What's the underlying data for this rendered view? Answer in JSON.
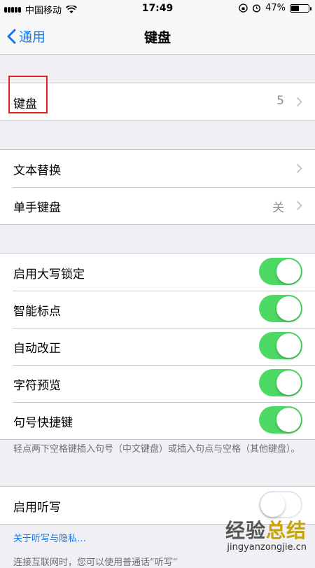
{
  "status_bar": {
    "carrier": "中国移动",
    "time": "17:49",
    "battery_percent": "47%",
    "battery_level": 0.47,
    "icons": [
      "signal-icon",
      "wifi-icon",
      "lock-rotation-icon",
      "alarm-icon",
      "battery-icon"
    ]
  },
  "nav": {
    "back_label": "通用",
    "title": "键盘"
  },
  "group1": {
    "keyboards": {
      "label": "键盘",
      "value": "5"
    }
  },
  "group2": {
    "text_replacement": {
      "label": "文本替换"
    },
    "one_handed": {
      "label": "单手键盘",
      "value": "关"
    }
  },
  "group3": {
    "caps_lock": {
      "label": "启用大写锁定",
      "on": true
    },
    "smart_punct": {
      "label": "智能标点",
      "on": true
    },
    "auto_correct": {
      "label": "自动改正",
      "on": true
    },
    "char_preview": {
      "label": "字符预览",
      "on": true
    },
    "period_shortcut": {
      "label": "句号快捷键",
      "on": true
    }
  },
  "footnote": "轻点两下空格键插入句号（中文键盘）或插入句点与空格（其他键盘）。",
  "group4": {
    "dictation": {
      "label": "启用听写",
      "on": false
    }
  },
  "dictation_link": "关于听写与隐私…",
  "cut_text": "连接互联网时，您可以使用普通话“听写”",
  "watermark": {
    "title_a": "经验",
    "title_b": "总结",
    "url": "jingyanzongjie.cn"
  },
  "colors": {
    "accent": "#1677f0",
    "toggle_on": "#4cd964",
    "highlight": "#e0251c"
  }
}
